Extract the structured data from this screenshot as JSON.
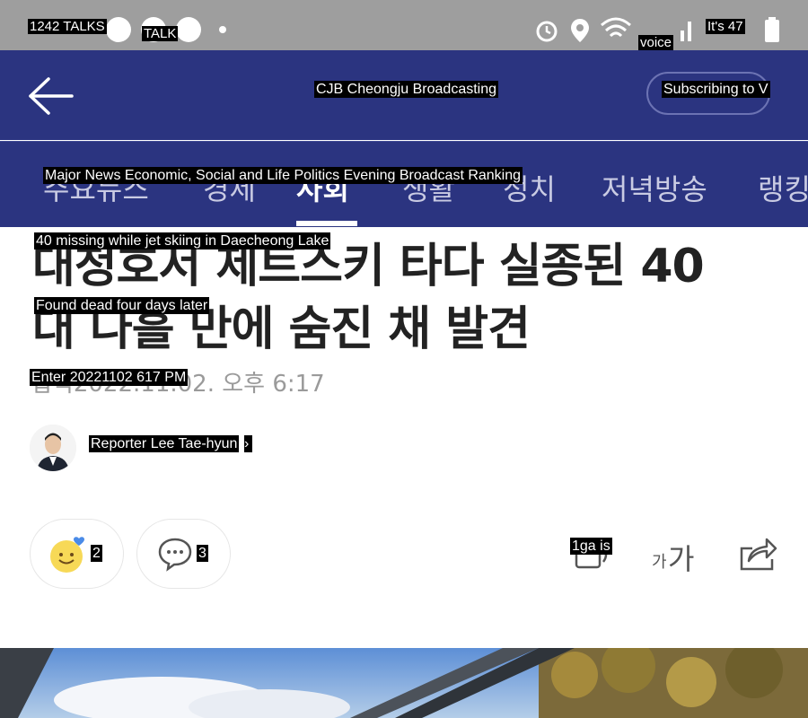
{
  "status_bar": {
    "left_label": "1242 TALKS",
    "talk_label": "TALK",
    "voice_label": "voice",
    "battery_label": "It's 47"
  },
  "header": {
    "title": "CJB Cheongju Broadcasting",
    "subscribe_label": "Subscribing to V"
  },
  "tabs": {
    "overlay_label": "Major News Economic, Social and Life Politics Evening Broadcast Ranking",
    "visible_korean": [
      "주요뉴스",
      "경제",
      "사회",
      "생활",
      "정치",
      "저녁방송",
      "랭킹"
    ]
  },
  "article": {
    "headline_line1": "40 missing while jet skiing in Daecheong Lake",
    "headline_line2": "Found dead four days later",
    "headline_korean_line1": "대청호서 제트스키 타다 실종된 40",
    "headline_korean_line2": "대 나흘 만에 숨진 채 발견",
    "entered": "Enter 20221102 617 PM",
    "entered_korean": "입력2022.11.02. 오후 6:17",
    "reporter": "Reporter Lee Tae-hyun"
  },
  "actions": {
    "reactions_count": "2",
    "comments_count": "3",
    "font_label": "1ga is",
    "font_glyph_small": "가",
    "font_glyph_large": "가"
  },
  "colors": {
    "header_bg": "#2b3480",
    "status_bg": "#9e9e9e"
  }
}
